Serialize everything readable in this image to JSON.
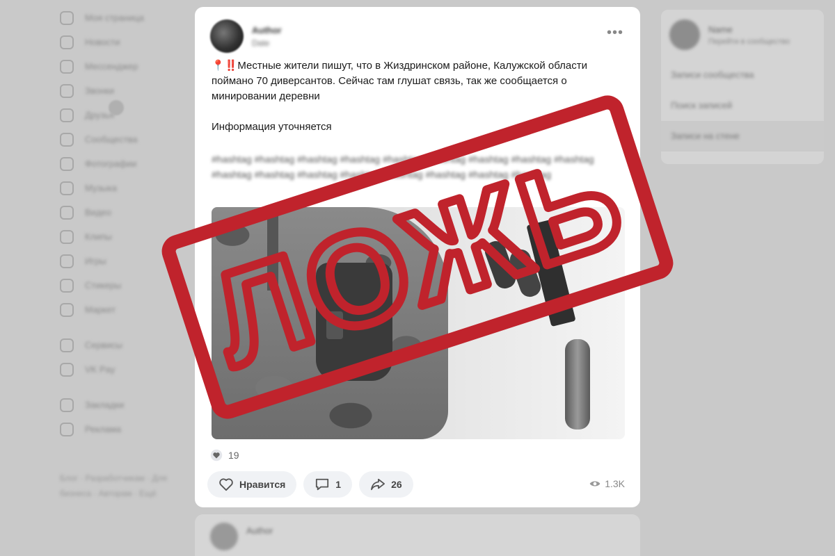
{
  "sidebar": {
    "items": [
      {
        "label": "Моя страница",
        "icon": "home-icon"
      },
      {
        "label": "Новости",
        "icon": "news-icon"
      },
      {
        "label": "Мессенджер",
        "icon": "chat-icon"
      },
      {
        "label": "Звонки",
        "icon": "phone-icon"
      },
      {
        "label": "Друзья",
        "icon": "friends-icon"
      },
      {
        "label": "Сообщества",
        "icon": "communities-icon"
      },
      {
        "label": "Фотографии",
        "icon": "photo-icon"
      },
      {
        "label": "Музыка",
        "icon": "music-icon"
      },
      {
        "label": "Видео",
        "icon": "video-icon"
      },
      {
        "label": "Клипы",
        "icon": "clips-icon"
      },
      {
        "label": "Игры",
        "icon": "games-icon"
      },
      {
        "label": "Стикеры",
        "icon": "stickers-icon"
      },
      {
        "label": "Маркет",
        "icon": "market-icon"
      }
    ],
    "items2": [
      {
        "label": "Сервисы",
        "icon": "services-icon"
      },
      {
        "label": "VK Pay",
        "icon": "pay-icon"
      }
    ],
    "items3": [
      {
        "label": "Закладки",
        "icon": "bookmark-icon"
      },
      {
        "label": "Реклама",
        "icon": "ads-icon"
      }
    ],
    "footer": "Блог · Разработчикам · Для бизнеса · Авторам · Ещё"
  },
  "right_panel": {
    "profile_name": "Name",
    "profile_sub": "Перейти в сообщество",
    "items": [
      "Записи сообщества",
      "Поиск записей",
      "Записи на стене"
    ]
  },
  "post": {
    "author": "Author",
    "date": "Date",
    "more_label": "•••",
    "paragraphs": [
      "📍‼️Местные жители пишут, что в Жиздринском районе, Калужской области поймано 70 диверсантов. Сейчас там глушат связь, так же сообщается о минировании деревни",
      "Информация уточняется"
    ],
    "hashtags": "#hashtag #hashtag #hashtag #hashtag #hashtag #hashtag #hashtag #hashtag #hashtag #hashtag #hashtag #hashtag #hashtag #hashtag #hashtag #hashtag #hashtag",
    "likes_count": "19",
    "actions": {
      "like_label": "Нравится",
      "comments_count": "1",
      "shares_count": "26"
    },
    "views": "1.3K"
  },
  "next_post": {
    "author": "Author"
  },
  "stamp": {
    "text": "ЛОЖЬ",
    "color": "#c0232c"
  }
}
